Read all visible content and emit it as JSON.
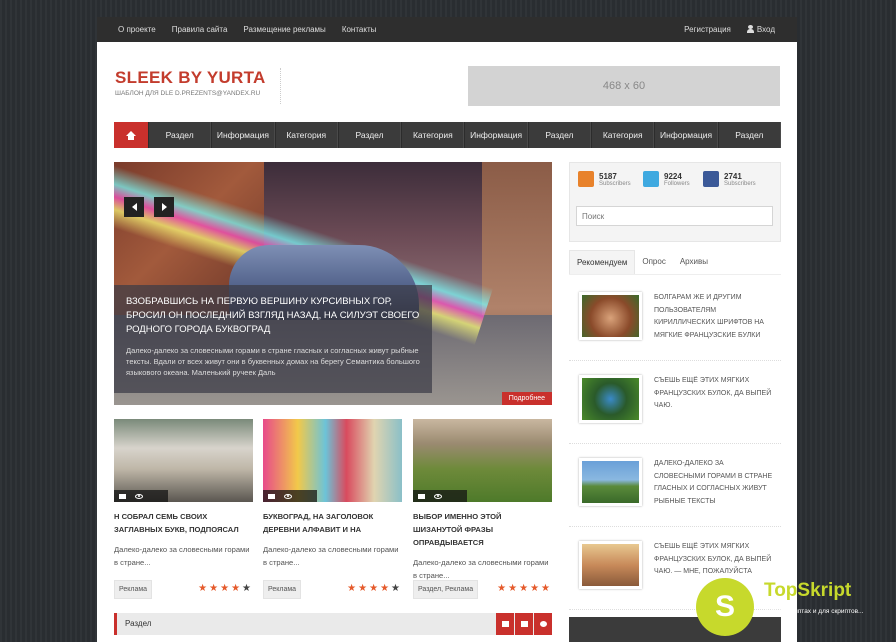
{
  "topbar": {
    "left": [
      "О проекте",
      "Правила сайта",
      "Размещение рекламы",
      "Контакты"
    ],
    "register": "Регистрация",
    "login": "Вход"
  },
  "header": {
    "logo_title": "SLEEK BY YURTA",
    "logo_subtitle": "ШАБЛОН ДЛЯ DLE D.PREZENTS@YANDEX.RU",
    "banner": "468 x 60"
  },
  "nav": [
    "Раздел",
    "Информация",
    "Категория",
    "Раздел",
    "Категория",
    "Информация",
    "Раздел",
    "Категория",
    "Информация",
    "Раздел"
  ],
  "slider": {
    "title": "ВЗОБРАВШИСЬ НА ПЕРВУЮ ВЕРШИНУ КУРСИВНЫХ ГОР, БРОСИЛ ОН ПОСЛЕДНИЙ ВЗГЛЯД НАЗАД, НА СИЛУЭТ СВОЕГО РОДНОГО ГОРОДА БУКВОГРАД",
    "text": "Далеко-далеко за словесными горами в стране гласных и согласных живут рыбные тексты. Вдали от всех живут они в буквенных домах на берегу Семантика большого языкового океана. Маленький ручеек Даль",
    "more": "Подробнее"
  },
  "cards": [
    {
      "title": "Н СОБРАЛ СЕМЬ СВОИХ ЗАГЛАВНЫХ БУКВ, ПОДПОЯСАЛ",
      "text": "Далеко-далеко за словесными горами в стране...",
      "tag": "Реклама",
      "rating": 4
    },
    {
      "title": "БУКВОГРАД, НА ЗАГОЛОВОК ДЕРЕВНИ АЛФАВИТ И НА",
      "text": "Далеко-далеко за словесными горами в стране...",
      "tag": "Реклама",
      "rating": 4
    },
    {
      "title": "ВЫБОР ИМЕННО ЭТОЙ ШИЗАНУТОЙ ФРАЗЫ ОПРАВДЫВАЕТСЯ",
      "text": "Далеко-далеко за словесными горами в стране...",
      "tag": "Раздел, Реклама",
      "rating": 5
    }
  ],
  "section": {
    "label": "Раздел"
  },
  "sidebar": {
    "social": [
      {
        "count": "5187",
        "label": "Subscribers",
        "icon": "rss-icon",
        "color": "#e8822b"
      },
      {
        "count": "9224",
        "label": "Followers",
        "icon": "twitter-icon",
        "color": "#3fa9e0"
      },
      {
        "count": "2741",
        "label": "Subscribers",
        "icon": "facebook-icon",
        "color": "#3b5998"
      }
    ],
    "search_placeholder": "Поиск",
    "tabs": [
      "Рекомендуем",
      "Опрос",
      "Архивы"
    ],
    "posts": [
      "БОЛГАРАМ ЖЕ И ДРУГИМ ПОЛЬЗОВАТЕЛЯМ КИРИЛЛИЧЕСКИХ ШРИФТОВ НА МЯГКИЕ ФРАНЦУЗСКИЕ БУЛКИ",
      "СЪЕШЬ ЕЩЁ ЭТИХ МЯГКИХ ФРАНЦУЗСКИХ БУЛОК, ДА ВЫПЕЙ ЧАЮ.",
      "ДАЛЕКО-ДАЛЕКО ЗА СЛОВЕСНЫМИ ГОРАМИ В СТРАНЕ ГЛАСНЫХ И СОГЛАСНЫХ ЖИВУТ РЫБНЫЕ ТЕКСТЫ",
      "СЪЕШЬ ЕЩЁ ЭТИХ МЯГКИХ ФРАНЦУЗСКИХ БУЛОК, ДА ВЫПЕЙ ЧАЮ. — МНЕ, ПОЖАЛУЙСТА"
    ]
  },
  "watermark": {
    "title": "TopSkript",
    "subtitle": "Всё о скриптах и для скриптов..."
  }
}
